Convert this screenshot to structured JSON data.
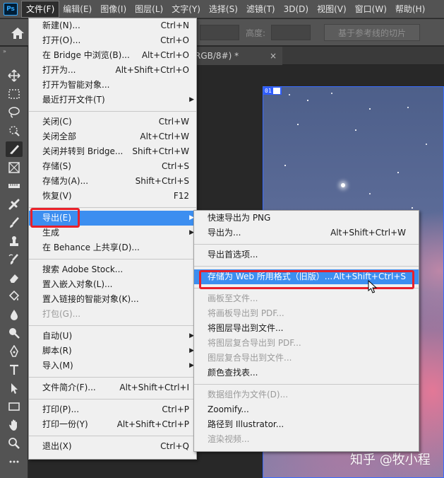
{
  "app": {
    "logo_text": "Ps"
  },
  "menubar": {
    "items": [
      "文件(F)",
      "编辑(E)",
      "图像(I)",
      "图层(L)",
      "文字(Y)",
      "选择(S)",
      "滤镜(T)",
      "3D(D)",
      "视图(V)",
      "窗口(W)",
      "帮助(H)"
    ],
    "active_index": 0
  },
  "options_bar": {
    "height_label": "高度:",
    "slice_button_label": "基于参考线的切片"
  },
  "document_tab": {
    "title": "RGB/8#) *",
    "close_glyph": "×"
  },
  "slice_tag": {
    "number": "01"
  },
  "file_menu": {
    "groups": [
      [
        {
          "label": "新建(N)...",
          "shortcut": "Ctrl+N"
        },
        {
          "label": "打开(O)...",
          "shortcut": "Ctrl+O"
        },
        {
          "label": "在 Bridge 中浏览(B)...",
          "shortcut": "Alt+Ctrl+O"
        },
        {
          "label": "打开为...",
          "shortcut": "Alt+Shift+Ctrl+O"
        },
        {
          "label": "打开为智能对象...",
          "shortcut": ""
        },
        {
          "label": "最近打开文件(T)",
          "shortcut": "",
          "submenu": true
        }
      ],
      [
        {
          "label": "关闭(C)",
          "shortcut": "Ctrl+W"
        },
        {
          "label": "关闭全部",
          "shortcut": "Alt+Ctrl+W"
        },
        {
          "label": "关闭并转到 Bridge...",
          "shortcut": "Shift+Ctrl+W"
        },
        {
          "label": "存储(S)",
          "shortcut": "Ctrl+S"
        },
        {
          "label": "存储为(A)...",
          "shortcut": "Shift+Ctrl+S"
        },
        {
          "label": "恢复(V)",
          "shortcut": "F12"
        }
      ],
      [
        {
          "label": "导出(E)",
          "shortcut": "",
          "submenu": true,
          "highlight": true
        },
        {
          "label": "生成",
          "shortcut": "",
          "submenu": true
        },
        {
          "label": "在 Behance 上共享(D)...",
          "shortcut": ""
        }
      ],
      [
        {
          "label": "搜索 Adobe Stock...",
          "shortcut": ""
        },
        {
          "label": "置入嵌入对象(L)...",
          "shortcut": ""
        },
        {
          "label": "置入链接的智能对象(K)...",
          "shortcut": ""
        },
        {
          "label": "打包(G)...",
          "shortcut": "",
          "disabled": true
        }
      ],
      [
        {
          "label": "自动(U)",
          "shortcut": "",
          "submenu": true
        },
        {
          "label": "脚本(R)",
          "shortcut": "",
          "submenu": true
        },
        {
          "label": "导入(M)",
          "shortcut": "",
          "submenu": true
        }
      ],
      [
        {
          "label": "文件简介(F)...",
          "shortcut": "Alt+Shift+Ctrl+I"
        }
      ],
      [
        {
          "label": "打印(P)...",
          "shortcut": "Ctrl+P"
        },
        {
          "label": "打印一份(Y)",
          "shortcut": "Alt+Shift+Ctrl+P"
        }
      ],
      [
        {
          "label": "退出(X)",
          "shortcut": "Ctrl+Q"
        }
      ]
    ]
  },
  "export_menu": {
    "groups": [
      [
        {
          "label": "快速导出为 PNG",
          "shortcut": ""
        },
        {
          "label": "导出为...",
          "shortcut": "Alt+Shift+Ctrl+W"
        }
      ],
      [
        {
          "label": "导出首选项...",
          "shortcut": ""
        }
      ],
      [
        {
          "label": "存储为 Web 所用格式（旧版）...",
          "shortcut": "Alt+Shift+Ctrl+S",
          "highlight": true
        }
      ],
      [
        {
          "label": "画板至文件...",
          "shortcut": "",
          "disabled": true
        },
        {
          "label": "将画板导出到 PDF...",
          "shortcut": "",
          "disabled": true
        },
        {
          "label": "将图层导出到文件...",
          "shortcut": ""
        },
        {
          "label": "将图层复合导出到 PDF...",
          "shortcut": "",
          "disabled": true
        },
        {
          "label": "图层复合导出到文件...",
          "shortcut": "",
          "disabled": true
        },
        {
          "label": "颜色查找表...",
          "shortcut": ""
        }
      ],
      [
        {
          "label": "数据组作为文件(D)...",
          "shortcut": "",
          "disabled": true
        },
        {
          "label": "Zoomify...",
          "shortcut": ""
        },
        {
          "label": "路径到 Illustrator...",
          "shortcut": ""
        },
        {
          "label": "渲染视频...",
          "shortcut": "",
          "disabled": true
        }
      ]
    ]
  },
  "watermark": {
    "text": "知乎 @牧小程"
  },
  "colors": {
    "highlight": "#3c8ef0",
    "callout_red": "#e8202a",
    "slice_blue": "#2f5dff"
  }
}
